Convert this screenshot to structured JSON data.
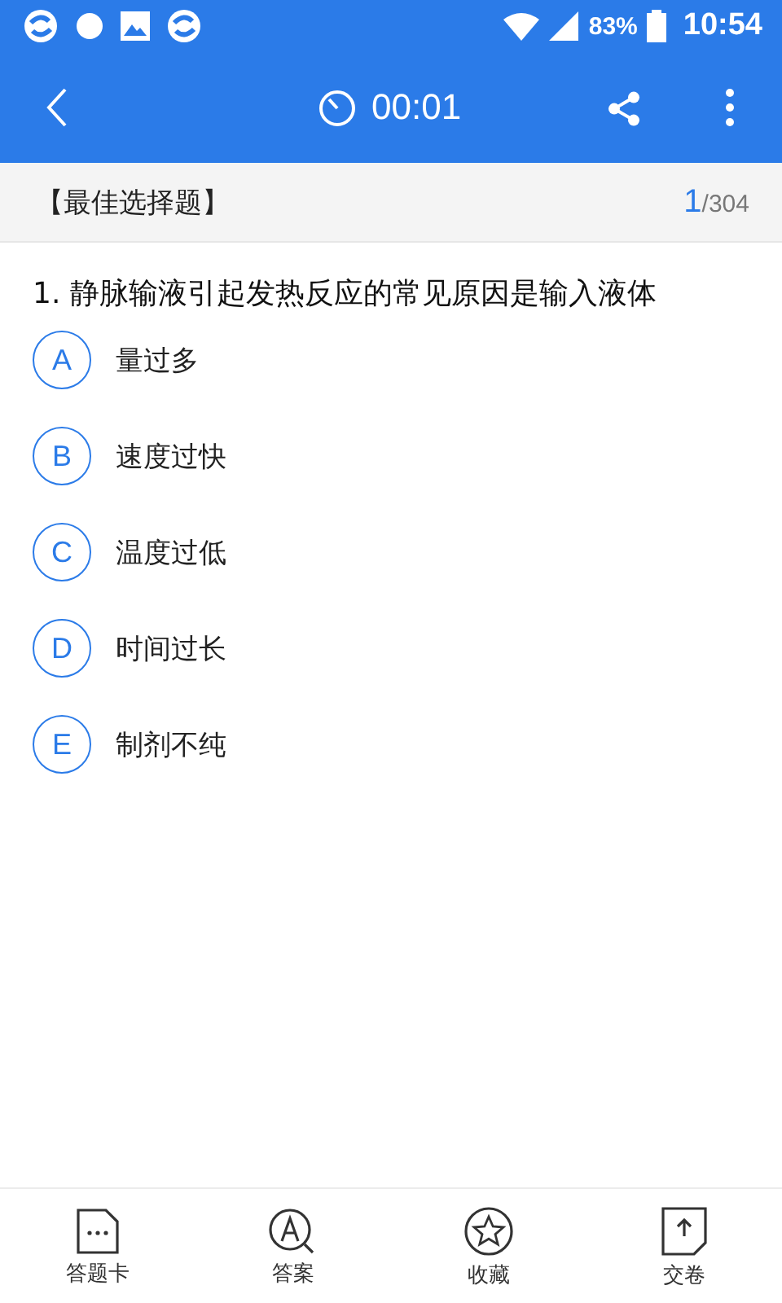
{
  "status_bar": {
    "battery": "83%",
    "time": "10:54"
  },
  "toolbar": {
    "timer": "00:01"
  },
  "section": {
    "title": "【最佳选择题】",
    "current": "1",
    "total": "/304"
  },
  "question": {
    "text": "1. 静脉输液引起发热反应的常见原因是输入液体"
  },
  "options": [
    {
      "letter": "A",
      "text": "量过多",
      "selected": false
    },
    {
      "letter": "B",
      "text": "速度过快",
      "selected": false
    },
    {
      "letter": "C",
      "text": "温度过低",
      "selected": false
    },
    {
      "letter": "D",
      "text": "时间过长",
      "selected": false
    },
    {
      "letter": "E",
      "text": "制剂不纯",
      "selected": false
    }
  ],
  "bottom_nav": [
    {
      "kind": "card",
      "label": "答题卡"
    },
    {
      "kind": "answer",
      "label": "答案"
    },
    {
      "kind": "favorite",
      "label": "收藏"
    },
    {
      "kind": "submit",
      "label": "交卷"
    }
  ]
}
